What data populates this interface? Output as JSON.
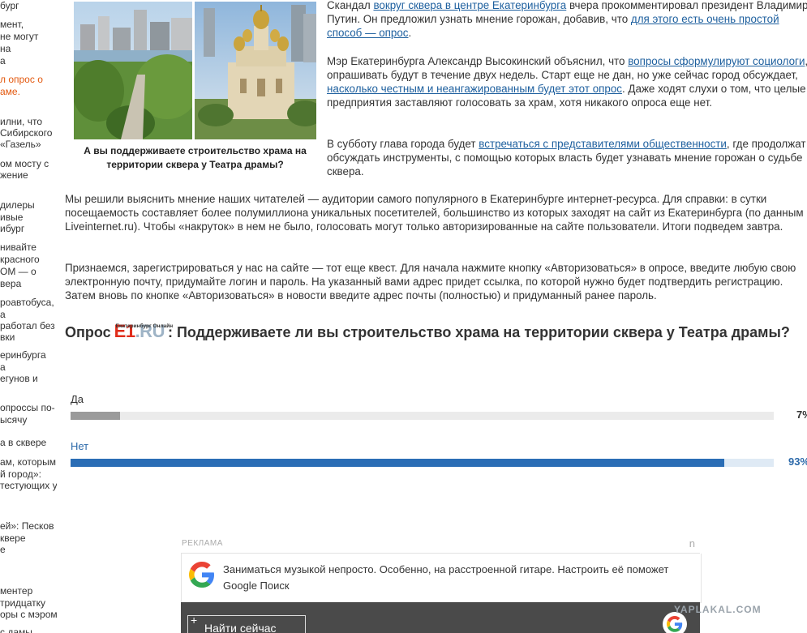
{
  "sidebar": {
    "items": [
      {
        "text": "бург"
      },
      {
        "text": "мент,"
      },
      {
        "text": "не могут"
      },
      {
        "text": "на"
      },
      {
        "text": "а"
      },
      {
        "text": "л опрос о",
        "red": true
      },
      {
        "text": "аме.",
        "red": true
      },
      {
        "text": "илни, что"
      },
      {
        "text": "Сибирского"
      },
      {
        "text": "«Газель»"
      },
      {
        "text": "ом мосту с"
      },
      {
        "text": "жение"
      },
      {
        "text": "дилеры"
      },
      {
        "text": "ивые"
      },
      {
        "text": "ибург"
      },
      {
        "text": "нивайте"
      },
      {
        "text": "красного"
      },
      {
        "text": "ОМ — о"
      },
      {
        "text": "вера"
      },
      {
        "text": "роавтобуса,"
      },
      {
        "text": "а"
      },
      {
        "text": "работал без"
      },
      {
        "text": "вки"
      },
      {
        "text": "еринбурга"
      },
      {
        "text": "а"
      },
      {
        "text": "егунов и"
      },
      {
        "text": "опроссы по-"
      },
      {
        "text": "ысячу"
      },
      {
        "text": "а в сквере"
      },
      {
        "text": "ам, которым"
      },
      {
        "text": "й город»:"
      },
      {
        "text": "тестующих у"
      },
      {
        "text": "ей»: Песков"
      },
      {
        "text": "квере"
      },
      {
        "text": "е"
      },
      {
        "text": "ментер"
      },
      {
        "text": "тридцатку"
      },
      {
        "text": "оры с мэром"
      },
      {
        "text": "с дамы"
      }
    ]
  },
  "image": {
    "caption": "А вы поддерживаете строительство храма на территории сквера у Театра драмы?"
  },
  "article": {
    "p1": {
      "t1": "Скандал ",
      "l1": "вокруг сквера в центре Екатеринбурга",
      "t2": " вчера прокомментировал президент Владимир Путин. Он предложил узнать мнение горожан, добавив, что ",
      "l2": "для этого есть очень простой способ — опрос",
      "t3": "."
    },
    "p2": {
      "t1": "Мэр Екатеринбурга Александр Высокинский объяснил, что ",
      "l1": "вопросы сформулируют социологи",
      "t2": ", опрашивать будут в течение двух недель. Старт еще не дан, но уже сейчас город обсуждает, ",
      "l2": "насколько честным и неангажированным будет этот опрос",
      "t3": ". Даже ходят слухи о том, что целые предприятия заставляют голосовать за храм, хотя никакого опроса еще нет."
    },
    "p3": {
      "t1": "В субботу глава города будет ",
      "l1": "встречаться с представителями общественности",
      "t2": ", где продолжат обсуждать инструменты, с помощью которых власть будет узнавать мнение горожан о судьбе сквера."
    },
    "p4": "Мы решили выяснить мнение наших читателей — аудитории самого популярного в Екатеринбурге интернет-ресурса. Для справки: в сутки посещаемость составляет более полумиллиона уникальных посетителей, большинство из которых заходят на сайт из Екатеринбурга (по данным Liveinternet.ru). Чтобы «накруток» в нем не было, голосовать могут только авторизированные на сайте пользователи. Итоги подведем завтра.",
    "p5": "Признаемся, зарегистрироваться у нас на сайте — тот еще квест. Для начала нажмите кнопку «Авторизоваться» в опросе, введите любую свою электронную почту, придумайте логин и пароль. На указанный вами адрес придет ссылка, по которой нужно будет подтвердить регистрацию. Затем вновь по кнопке «Авторизоваться» в новости введите адрес почты (полностью) и придуманный ранее пароль."
  },
  "poll": {
    "prefix": "Опрос",
    "logo_small": "Екатеринбург Онлайн",
    "logo_e1": "E1",
    "logo_ru": ".RU",
    "question": ": Поддерживаете ли вы строительство храма на территории сквера у Театра драмы?",
    "options": [
      {
        "label": "Да",
        "percent": 7,
        "percent_text": "7%",
        "color": "#9b9b9b",
        "track": "#ebebeb"
      },
      {
        "label": "Нет",
        "percent": 93,
        "percent_text": "93%",
        "color": "#2a6db5",
        "track": "#dfeaf5"
      }
    ]
  },
  "ad": {
    "label": "РЕКЛАМА",
    "corner": "n",
    "text": "Заниматься музыкой непросто. Особенно, на расстроенной гитаре. Настроить её поможет Google Поиск",
    "button": "Найти сейчас",
    "plus": "+"
  },
  "watermark": "YAPLAKAL.COM",
  "colors": {
    "link": "#1d5f9e",
    "e1_red": "#e02d1b",
    "accent_blue": "#2a6db5"
  }
}
